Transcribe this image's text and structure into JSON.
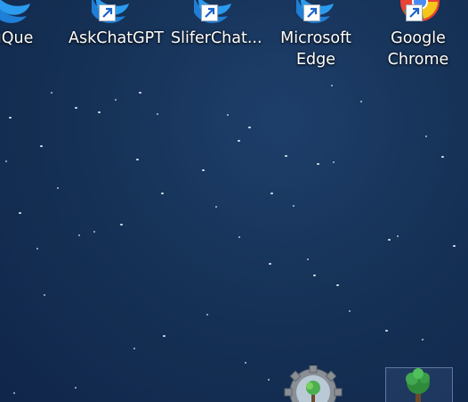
{
  "desktop": {
    "icons": [
      {
        "label": "uQue",
        "icon": "edge-blue-icon"
      },
      {
        "label": "AskChatGPT",
        "icon": "edge-blue-icon"
      },
      {
        "label": "SliferChat...",
        "icon": "edge-blue-icon"
      },
      {
        "label": "Microsoft\nEdge",
        "line1": "Microsoft",
        "line2": "Edge",
        "icon": "edge-blue-icon"
      },
      {
        "label": "Google\nChrome",
        "line1": "Google",
        "line2": "Chrome",
        "icon": "chrome-icon"
      }
    ],
    "bottom_items": [
      {
        "icon": "terraria-server-gear-icon"
      },
      {
        "icon": "terraria-tree-icon"
      }
    ]
  },
  "colors": {
    "wallpaper": "#163257",
    "edge_blue": "#1a73c9",
    "chrome_yellow": "#f5c518",
    "chrome_green": "#2aa84a"
  }
}
